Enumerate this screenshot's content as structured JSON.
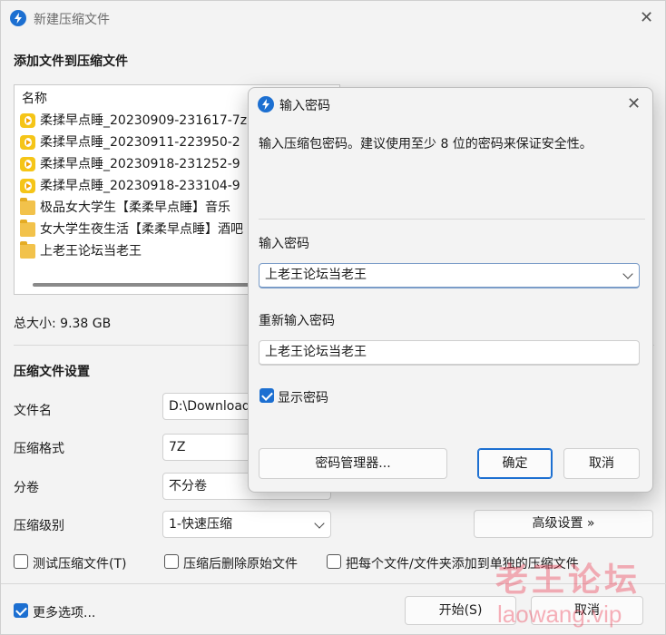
{
  "window": {
    "title": "新建压缩文件"
  },
  "add_section": {
    "heading": "添加文件到压缩文件",
    "column_header": "名称",
    "items": [
      {
        "name": "柔揉早点睡_20230909-231617-7z",
        "type": "media"
      },
      {
        "name": "柔揉早点睡_20230911-223950-2",
        "type": "media"
      },
      {
        "name": "柔揉早点睡_20230918-231252-9",
        "type": "media"
      },
      {
        "name": "柔揉早点睡_20230918-233104-9",
        "type": "media"
      },
      {
        "name": "极品女大学生【柔柔早点睡】音乐",
        "type": "folder"
      },
      {
        "name": "女大学生夜生活【柔柔早点睡】酒吧",
        "type": "folder"
      },
      {
        "name": "上老王论坛当老王",
        "type": "folder"
      }
    ],
    "total_size": "总大小: 9.38 GB"
  },
  "settings": {
    "heading": "压缩文件设置",
    "filename_label": "文件名",
    "filename_value": "D:\\Download",
    "format_label": "压缩格式",
    "format_value": "7Z",
    "volume_label": "分卷",
    "volume_value": "不分卷",
    "level_label": "压缩级别",
    "level_value": "1-快速压缩",
    "advanced_button": "高级设置 »",
    "test_checkbox": "测试压缩文件(T)",
    "delete_checkbox": "压缩后删除原始文件",
    "separate_checkbox": "把每个文件/文件夹添加到单独的压缩文件",
    "more_options": "更多选项...",
    "start_button": "开始(S)",
    "cancel_button": "取消"
  },
  "dialog": {
    "title": "输入密码",
    "description": "输入压缩包密码。建议使用至少 8 位的密码来保证安全性。",
    "password_label": "输入密码",
    "password_value": "上老王论坛当老王",
    "confirm_label": "重新输入密码",
    "confirm_value": "上老王论坛当老王",
    "show_password": "显示密码",
    "manager_button": "密码管理器...",
    "ok_button": "确定",
    "cancel_button": "取消"
  },
  "watermark": {
    "line1": "老王论坛",
    "line2": "laowang.vip"
  },
  "colors": {
    "accent": "#1c6fd1",
    "folder": "#f2c24b",
    "media": "#f5c518",
    "watermark": "#eb465a"
  }
}
